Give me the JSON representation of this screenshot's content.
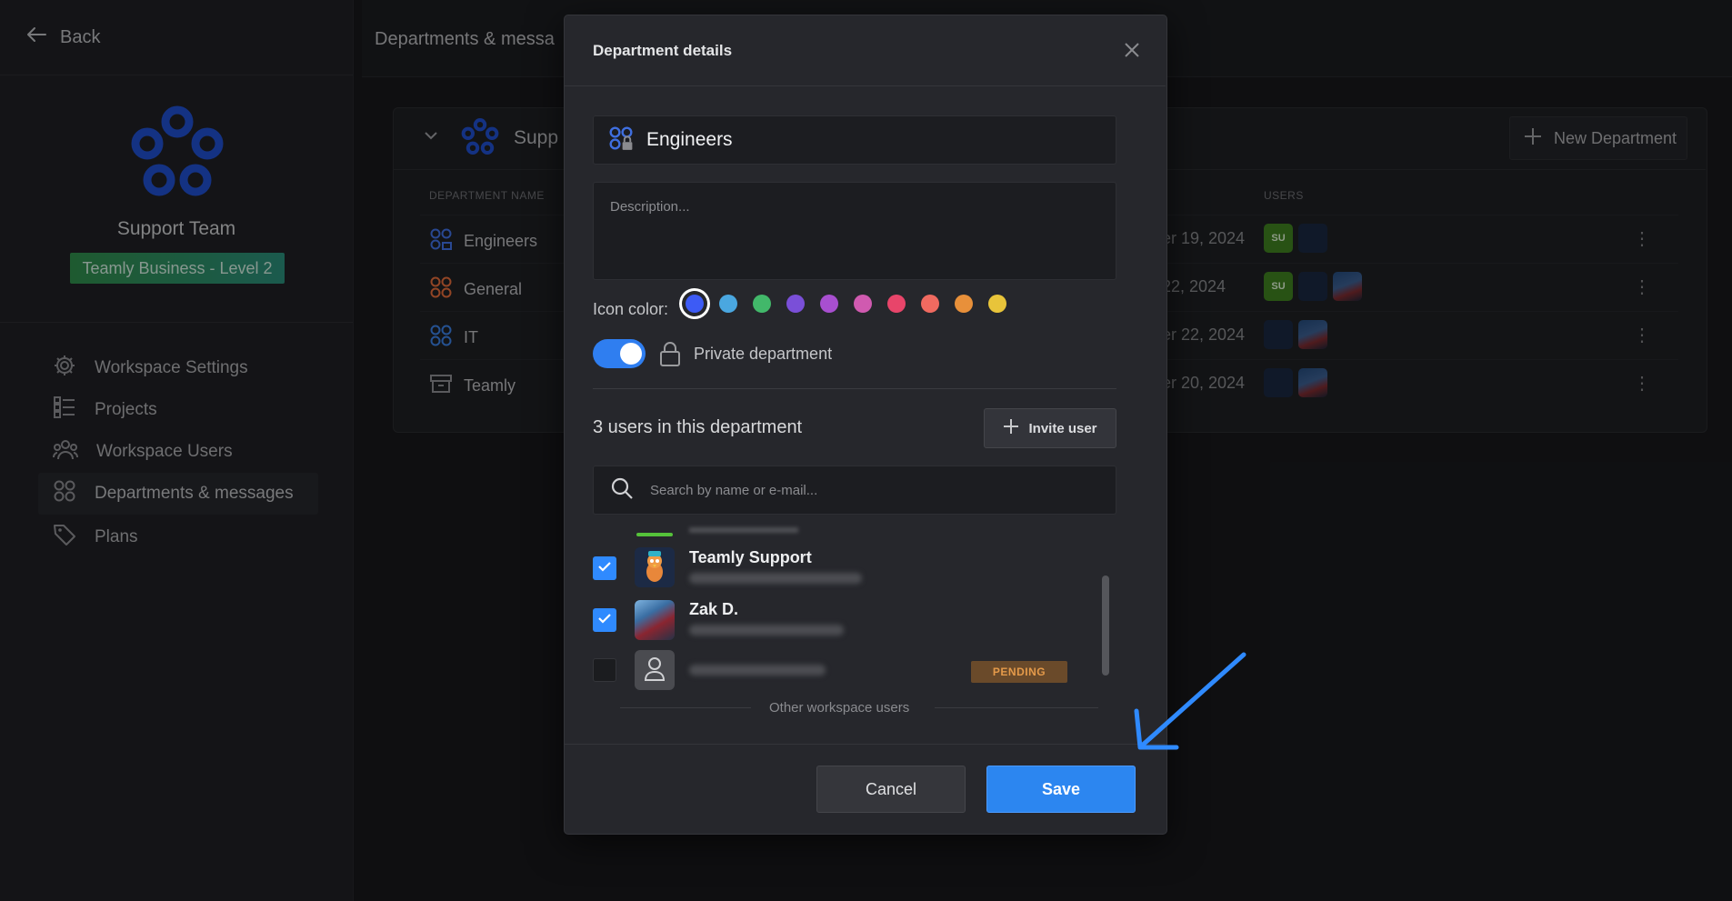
{
  "sidebar": {
    "back_label": "Back",
    "team_name": "Support Team",
    "plan_badge": "Teamly Business - Level 2",
    "items": [
      {
        "label": "Workspace Settings",
        "icon": "gear-icon"
      },
      {
        "label": "Projects",
        "icon": "list-icon"
      },
      {
        "label": "Workspace Users",
        "icon": "users-icon"
      },
      {
        "label": "Departments & messages",
        "icon": "grid-icon",
        "active": true
      },
      {
        "label": "Plans",
        "icon": "tag-icon"
      }
    ]
  },
  "header": {
    "title": "Departments & messa"
  },
  "card": {
    "title": "Supp",
    "new_department_label": "New Department",
    "columns": {
      "name": "DEPARTMENT NAME",
      "users": "USERS"
    },
    "rows": [
      {
        "name": "Engineers",
        "date": "er 19, 2024",
        "icon_color": "#3f6fe0"
      },
      {
        "name": "General",
        "date": "22, 2024",
        "icon_color": "#e06a3a"
      },
      {
        "name": "IT",
        "date": "er 22, 2024",
        "icon_color": "#3a7ee0"
      },
      {
        "name": "Teamly",
        "date": "er 20, 2024",
        "icon_color": "#8a8b8f"
      }
    ],
    "avatar_su_text": "SU"
  },
  "modal": {
    "title": "Department details",
    "name_value": "Engineers",
    "description_placeholder": "Description...",
    "icon_color_label": "Icon color:",
    "swatches": [
      "#3d5bf5",
      "#4aa7e0",
      "#42b86a",
      "#7a4fd8",
      "#a84fd0",
      "#d05ab0",
      "#e8456a",
      "#f06a60",
      "#e8903a",
      "#e8c43a"
    ],
    "selected_swatch": "#3d5bf5",
    "private_label": "Private department",
    "private_enabled": true,
    "users_count_label": "3 users in this department",
    "invite_label": "Invite user",
    "search_placeholder": "Search by name or e-mail...",
    "users": [
      {
        "name": "Teamly Support",
        "checked": true
      },
      {
        "name": "Zak D.",
        "checked": true
      },
      {
        "name": "",
        "checked": false,
        "badge": "PENDING"
      }
    ],
    "other_users_label": "Other workspace users",
    "cancel_label": "Cancel",
    "save_label": "Save"
  },
  "colors": {
    "accent": "#2c86f0",
    "pending": "#e49a4a",
    "annotation_arrow": "#2f8aff"
  }
}
